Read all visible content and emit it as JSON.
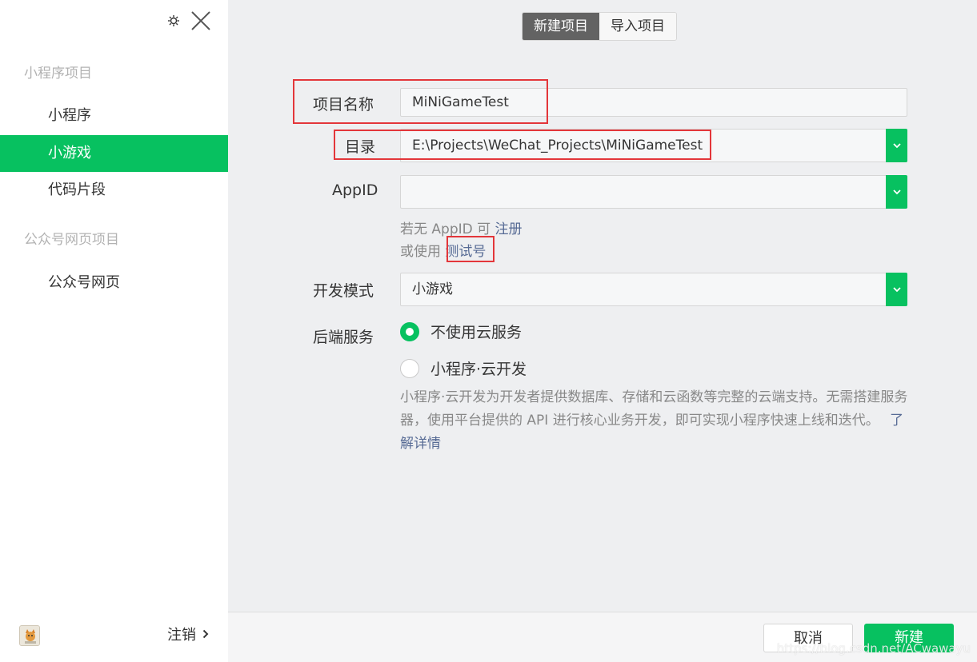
{
  "sidebar": {
    "section_miniprogram": "小程序项目",
    "items_miniprogram": [
      "小程序",
      "小游戏",
      "代码片段"
    ],
    "active_item": "小游戏",
    "section_official": "公众号网页项目",
    "items_official": [
      "公众号网页"
    ],
    "logout_label": "注销"
  },
  "header": {
    "tabs": [
      "新建项目",
      "导入项目"
    ],
    "active_tab": "新建项目"
  },
  "form": {
    "project_name_label": "项目名称",
    "project_name_value": "MiNiGameTest",
    "directory_label": "目录",
    "directory_value": "E:\\Projects\\WeChat_Projects\\MiNiGameTest",
    "appid_label": "AppID",
    "appid_value": "",
    "appid_hint_prefix": "若无 AppID 可",
    "appid_register_link": "注册",
    "appid_test_prefix": "或使用",
    "appid_test_link": "测试号",
    "dev_mode_label": "开发模式",
    "dev_mode_value": "小游戏",
    "backend_label": "后端服务",
    "backend_options": [
      "不使用云服务",
      "小程序·云开发"
    ],
    "backend_selected": "不使用云服务",
    "cloud_desc": "小程序·云开发为开发者提供数据库、存储和云函数等完整的云端支持。无需搭建服务器，使用平台提供的 API 进行核心业务开发，即可实现小程序快速上线和迭代。",
    "cloud_link": "了解详情"
  },
  "footer": {
    "cancel_label": "取消",
    "create_label": "新建"
  },
  "watermark": "https://blog.csdn.net/ACwawayu",
  "colors": {
    "accent": "#07c160",
    "link": "#576b95",
    "highlight_box": "#e3363a"
  }
}
